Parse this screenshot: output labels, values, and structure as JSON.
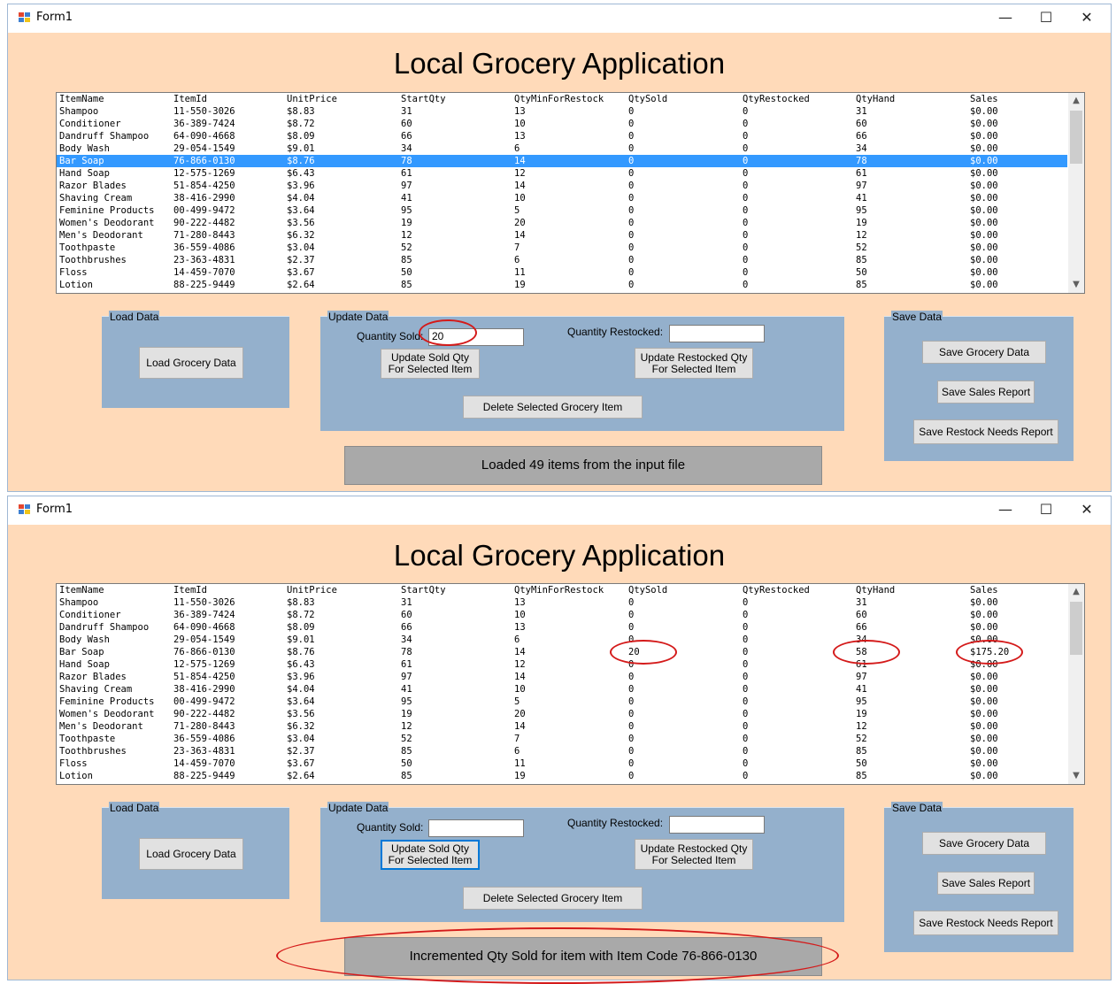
{
  "window": {
    "title": "Form1",
    "minimize": "—",
    "maximize": "☐",
    "close": "✕"
  },
  "heading": "Local Grocery Application",
  "columns": [
    "ItemName",
    "ItemId",
    "UnitPrice",
    "StartQty",
    "QtyMinForRestock",
    "QtySold",
    "QtyRestocked",
    "QtyHand",
    "Sales"
  ],
  "groups": {
    "load": "Load Data",
    "update": "Update Data",
    "save": "Save Data"
  },
  "buttons": {
    "load_grocery": "Load Grocery Data",
    "update_sold": "Update Sold Qty\nFor Selected Item",
    "update_restocked": "Update Restocked Qty\nFor Selected Item",
    "delete_item": "Delete Selected Grocery Item",
    "save_grocery": "Save Grocery Data",
    "save_sales": "Save Sales Report",
    "save_restock": "Save Restock Needs Report"
  },
  "labels": {
    "qty_sold": "Quantity Sold:",
    "qty_restocked": "Quantity Restocked:"
  },
  "colors": {
    "form_bg": "#ffdab9",
    "group_bg": "#94b0cc",
    "selection": "#3399ff",
    "annotation": "#d41a1a"
  },
  "screens": [
    {
      "qty_sold_value": "20",
      "qty_restocked_value": "",
      "status": "Loaded 49 items from the input file",
      "selected_row": 4,
      "rows": [
        [
          "Shampoo",
          "11-550-3026",
          "$8.83",
          "31",
          "13",
          "0",
          "0",
          "31",
          "$0.00"
        ],
        [
          "Conditioner",
          "36-389-7424",
          "$8.72",
          "60",
          "10",
          "0",
          "0",
          "60",
          "$0.00"
        ],
        [
          "Dandruff Shampoo",
          "64-090-4668",
          "$8.09",
          "66",
          "13",
          "0",
          "0",
          "66",
          "$0.00"
        ],
        [
          "Body Wash",
          "29-054-1549",
          "$9.01",
          "34",
          "6",
          "0",
          "0",
          "34",
          "$0.00"
        ],
        [
          "Bar Soap",
          "76-866-0130",
          "$8.76",
          "78",
          "14",
          "0",
          "0",
          "78",
          "$0.00"
        ],
        [
          "Hand Soap",
          "12-575-1269",
          "$6.43",
          "61",
          "12",
          "0",
          "0",
          "61",
          "$0.00"
        ],
        [
          "Razor Blades",
          "51-854-4250",
          "$3.96",
          "97",
          "14",
          "0",
          "0",
          "97",
          "$0.00"
        ],
        [
          "Shaving Cream",
          "38-416-2990",
          "$4.04",
          "41",
          "10",
          "0",
          "0",
          "41",
          "$0.00"
        ],
        [
          "Feminine Products",
          "00-499-9472",
          "$3.64",
          "95",
          "5",
          "0",
          "0",
          "95",
          "$0.00"
        ],
        [
          "Women's Deodorant",
          "90-222-4482",
          "$3.56",
          "19",
          "20",
          "0",
          "0",
          "19",
          "$0.00"
        ],
        [
          "Men's Deodorant",
          "71-280-8443",
          "$6.32",
          "12",
          "14",
          "0",
          "0",
          "12",
          "$0.00"
        ],
        [
          "Toothpaste",
          "36-559-4086",
          "$3.04",
          "52",
          "7",
          "0",
          "0",
          "52",
          "$0.00"
        ],
        [
          "Toothbrushes",
          "23-363-4831",
          "$2.37",
          "85",
          "6",
          "0",
          "0",
          "85",
          "$0.00"
        ],
        [
          "Floss",
          "14-459-7070",
          "$3.67",
          "50",
          "11",
          "0",
          "0",
          "50",
          "$0.00"
        ],
        [
          "Lotion",
          "88-225-9449",
          "$2.64",
          "85",
          "19",
          "0",
          "0",
          "85",
          "$0.00"
        ]
      ]
    },
    {
      "qty_sold_value": "",
      "qty_restocked_value": "",
      "status": "Incremented Qty Sold for item with Item Code 76-866-0130",
      "selected_row": -1,
      "rows": [
        [
          "Shampoo",
          "11-550-3026",
          "$8.83",
          "31",
          "13",
          "0",
          "0",
          "31",
          "$0.00"
        ],
        [
          "Conditioner",
          "36-389-7424",
          "$8.72",
          "60",
          "10",
          "0",
          "0",
          "60",
          "$0.00"
        ],
        [
          "Dandruff Shampoo",
          "64-090-4668",
          "$8.09",
          "66",
          "13",
          "0",
          "0",
          "66",
          "$0.00"
        ],
        [
          "Body Wash",
          "29-054-1549",
          "$9.01",
          "34",
          "6",
          "0",
          "0",
          "34",
          "$0.00"
        ],
        [
          "Bar Soap",
          "76-866-0130",
          "$8.76",
          "78",
          "14",
          "20",
          "0",
          "58",
          "$175.20"
        ],
        [
          "Hand Soap",
          "12-575-1269",
          "$6.43",
          "61",
          "12",
          "0",
          "0",
          "61",
          "$0.00"
        ],
        [
          "Razor Blades",
          "51-854-4250",
          "$3.96",
          "97",
          "14",
          "0",
          "0",
          "97",
          "$0.00"
        ],
        [
          "Shaving Cream",
          "38-416-2990",
          "$4.04",
          "41",
          "10",
          "0",
          "0",
          "41",
          "$0.00"
        ],
        [
          "Feminine Products",
          "00-499-9472",
          "$3.64",
          "95",
          "5",
          "0",
          "0",
          "95",
          "$0.00"
        ],
        [
          "Women's Deodorant",
          "90-222-4482",
          "$3.56",
          "19",
          "20",
          "0",
          "0",
          "19",
          "$0.00"
        ],
        [
          "Men's Deodorant",
          "71-280-8443",
          "$6.32",
          "12",
          "14",
          "0",
          "0",
          "12",
          "$0.00"
        ],
        [
          "Toothpaste",
          "36-559-4086",
          "$3.04",
          "52",
          "7",
          "0",
          "0",
          "52",
          "$0.00"
        ],
        [
          "Toothbrushes",
          "23-363-4831",
          "$2.37",
          "85",
          "6",
          "0",
          "0",
          "85",
          "$0.00"
        ],
        [
          "Floss",
          "14-459-7070",
          "$3.67",
          "50",
          "11",
          "0",
          "0",
          "50",
          "$0.00"
        ],
        [
          "Lotion",
          "88-225-9449",
          "$2.64",
          "85",
          "19",
          "0",
          "0",
          "85",
          "$0.00"
        ]
      ]
    }
  ]
}
